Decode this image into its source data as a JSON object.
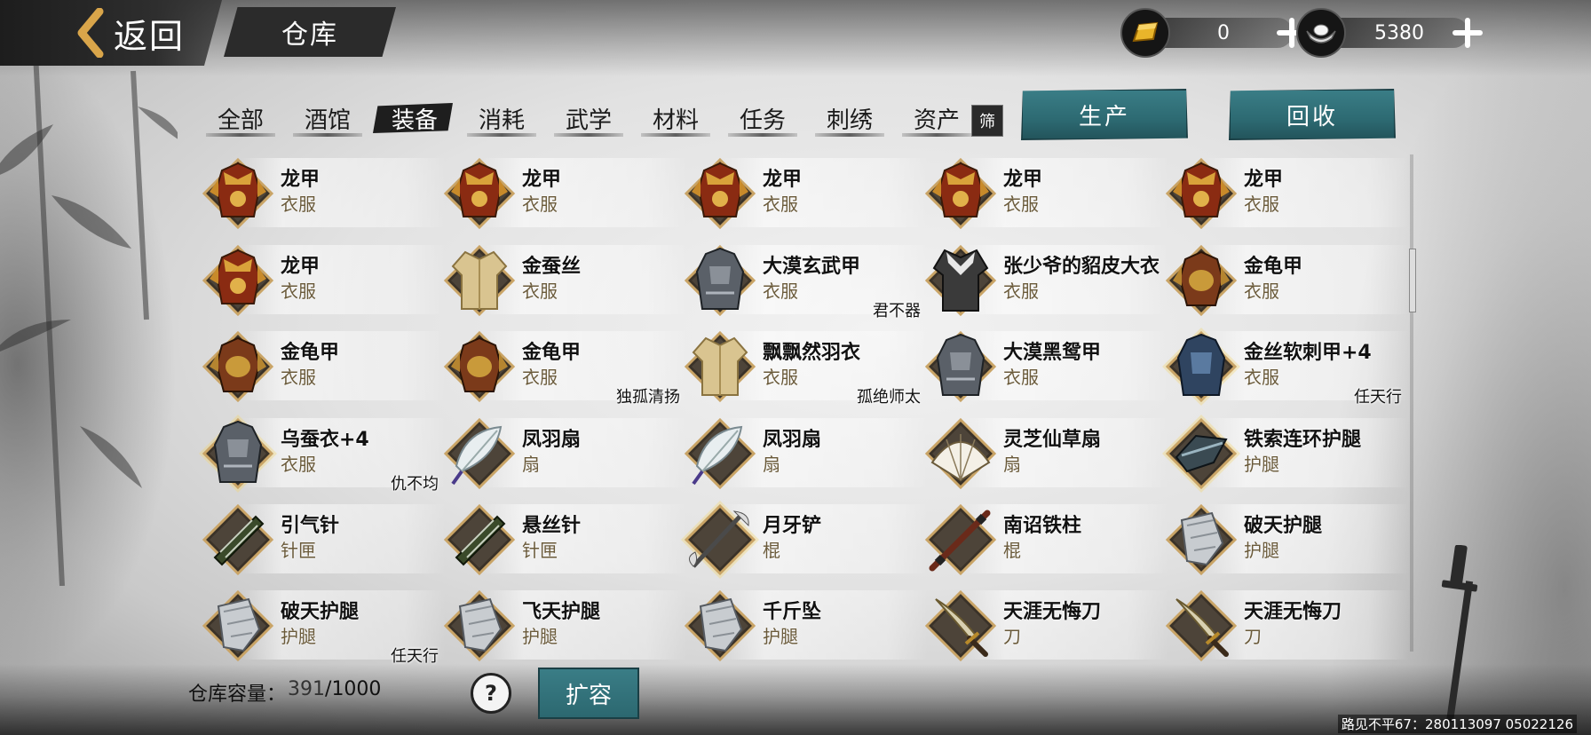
{
  "header": {
    "back_label": "返回",
    "title": "仓库",
    "gold": "0",
    "silver": "5380"
  },
  "tabs": [
    {
      "label": "全部",
      "active": false
    },
    {
      "label": "酒馆",
      "active": false
    },
    {
      "label": "装备",
      "active": true
    },
    {
      "label": "消耗",
      "active": false
    },
    {
      "label": "武学",
      "active": false
    },
    {
      "label": "材料",
      "active": false
    },
    {
      "label": "任务",
      "active": false
    },
    {
      "label": "刺绣",
      "active": false
    },
    {
      "label": "资产",
      "active": false
    }
  ],
  "filter_label": "筛",
  "actions": {
    "produce": "生产",
    "recycle": "回收"
  },
  "items": [
    {
      "name": "龙甲",
      "type": "衣服",
      "owner": "",
      "icon": "dragon-armor-icon"
    },
    {
      "name": "龙甲",
      "type": "衣服",
      "owner": "",
      "icon": "dragon-armor-icon"
    },
    {
      "name": "龙甲",
      "type": "衣服",
      "owner": "",
      "icon": "dragon-armor-icon"
    },
    {
      "name": "龙甲",
      "type": "衣服",
      "owner": "",
      "icon": "dragon-armor-icon"
    },
    {
      "name": "龙甲",
      "type": "衣服",
      "owner": "",
      "icon": "dragon-armor-icon"
    },
    {
      "name": "龙甲",
      "type": "衣服",
      "owner": "",
      "icon": "dragon-armor-icon"
    },
    {
      "name": "金蚕丝",
      "type": "衣服",
      "owner": "",
      "icon": "robe-icon"
    },
    {
      "name": "大漠玄武甲",
      "type": "衣服",
      "owner": "君不器",
      "icon": "gray-armor-icon"
    },
    {
      "name": "张少爷的貂皮大衣",
      "type": "衣服",
      "owner": "",
      "icon": "fur-coat-icon"
    },
    {
      "name": "金龟甲",
      "type": "衣服",
      "owner": "",
      "icon": "turtle-armor-icon"
    },
    {
      "name": "金龟甲",
      "type": "衣服",
      "owner": "",
      "icon": "turtle-armor-icon"
    },
    {
      "name": "金龟甲",
      "type": "衣服",
      "owner": "独孤清扬",
      "icon": "turtle-armor-icon"
    },
    {
      "name": "飘飘然羽衣",
      "type": "衣服",
      "owner": "孤绝师太",
      "icon": "robe-icon"
    },
    {
      "name": "大漠黑鸳甲",
      "type": "衣服",
      "owner": "",
      "icon": "gray-armor-icon"
    },
    {
      "name": "金丝软刺甲+4",
      "type": "衣服",
      "owner": "任天行",
      "icon": "blue-armor-icon"
    },
    {
      "name": "乌蚕衣+4",
      "type": "衣服",
      "owner": "仇不均",
      "icon": "gray-armor-icon"
    },
    {
      "name": "凤羽扇",
      "type": "扇",
      "owner": "",
      "icon": "feather-fan-icon"
    },
    {
      "name": "凤羽扇",
      "type": "扇",
      "owner": "",
      "icon": "feather-fan-icon"
    },
    {
      "name": "灵芝仙草扇",
      "type": "扇",
      "owner": "",
      "icon": "folding-fan-icon"
    },
    {
      "name": "铁索连环护腿",
      "type": "护腿",
      "owner": "",
      "icon": "chain-greaves-icon"
    },
    {
      "name": "引气针",
      "type": "针匣",
      "owner": "",
      "icon": "needle-case-icon"
    },
    {
      "name": "悬丝针",
      "type": "针匣",
      "owner": "",
      "icon": "needle-case-icon"
    },
    {
      "name": "月牙铲",
      "type": "棍",
      "owner": "",
      "icon": "crescent-spade-icon"
    },
    {
      "name": "南诏铁柱",
      "type": "棍",
      "owner": "",
      "icon": "staff-icon"
    },
    {
      "name": "破天护腿",
      "type": "护腿",
      "owner": "",
      "icon": "greaves-icon"
    },
    {
      "name": "破天护腿",
      "type": "护腿",
      "owner": "任天行",
      "icon": "greaves-icon"
    },
    {
      "name": "飞天护腿",
      "type": "护腿",
      "owner": "",
      "icon": "greaves-icon"
    },
    {
      "name": "千斤坠",
      "type": "护腿",
      "owner": "",
      "icon": "greaves-icon"
    },
    {
      "name": "天涯无悔刀",
      "type": "刀",
      "owner": "",
      "icon": "saber-icon"
    },
    {
      "name": "天涯无悔刀",
      "type": "刀",
      "owner": "",
      "icon": "saber-icon"
    }
  ],
  "footer": {
    "capacity_label": "仓库容量：",
    "capacity_used": "391",
    "capacity_sep": "/",
    "capacity_total": "1000",
    "help": "?",
    "expand": "扩容",
    "player_id": "路见不平67：280113097  05022126"
  }
}
